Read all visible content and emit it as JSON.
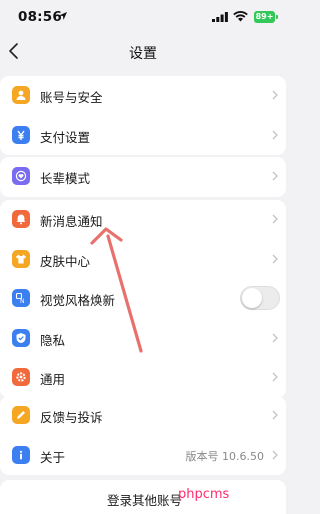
{
  "status_bar": {
    "time": "08:56",
    "battery": "89+"
  },
  "nav": {
    "title": "设置"
  },
  "groups": [
    {
      "items": [
        {
          "label": "账号与安全",
          "icon": "person-icon",
          "color": "#f5a623"
        },
        {
          "label": "支付设置",
          "icon": "yen-icon",
          "color": "#3b7ff0"
        }
      ]
    },
    {
      "items": [
        {
          "label": "长辈模式",
          "icon": "elder-heart-icon",
          "color": "#7a6cf0"
        }
      ]
    },
    {
      "items": [
        {
          "label": "新消息通知",
          "icon": "bell-icon",
          "color": "#f2693c"
        },
        {
          "label": "皮肤中心",
          "icon": "shirt-icon",
          "color": "#f5a623"
        },
        {
          "label": "视觉风格焕新",
          "icon": "new-style-icon",
          "color": "#3b7ff0",
          "toggle": false
        },
        {
          "label": "隐私",
          "icon": "shield-check-icon",
          "color": "#3b7ff0"
        },
        {
          "label": "通用",
          "icon": "gear-icon",
          "color": "#f2693c"
        }
      ]
    },
    {
      "items": [
        {
          "label": "反馈与投诉",
          "icon": "pencil-icon",
          "color": "#f5a623"
        },
        {
          "label": "关于",
          "icon": "info-icon",
          "color": "#3b7ff0",
          "value": "版本号 10.6.50"
        }
      ]
    }
  ],
  "login": {
    "label": "登录其他账号"
  },
  "watermark": "phpcms",
  "annotation": {
    "arrow_color": "#e8716e"
  }
}
